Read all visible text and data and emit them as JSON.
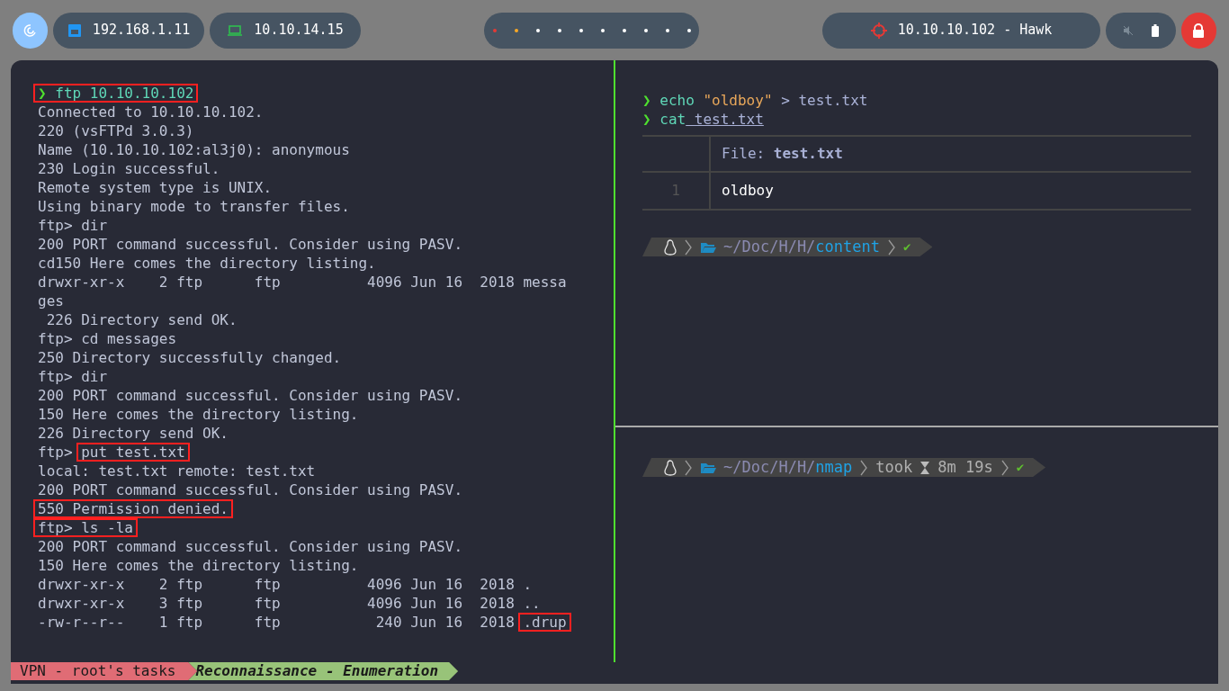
{
  "topbar": {
    "ips": [
      {
        "kind": "ethernet",
        "text": "192.168.1.11"
      },
      {
        "kind": "laptop",
        "text": "10.10.14.15"
      }
    ],
    "workspaces": [
      {
        "color": "#e53935"
      },
      {
        "color": "#f9a825"
      },
      {
        "color": "#ffffff"
      },
      {
        "color": "#ffffff"
      },
      {
        "color": "#ffffff"
      },
      {
        "color": "#ffffff"
      },
      {
        "color": "#ffffff"
      },
      {
        "color": "#ffffff"
      },
      {
        "color": "#ffffff"
      },
      {
        "color": "#ffffff"
      }
    ],
    "target": "10.10.10.102 - Hawk"
  },
  "left_pane": {
    "lines": [
      {
        "kind": "prompt",
        "segments": [
          {
            "text": "❯ ftp 10.10.10.102",
            "boxed": true
          }
        ]
      },
      {
        "kind": "output",
        "segments": [
          {
            "text": "Connected to 10.10.10.102.",
            "boxed": false
          }
        ]
      },
      {
        "kind": "output",
        "segments": [
          {
            "text": "220 (vsFTPd 3.0.3)",
            "boxed": false
          }
        ]
      },
      {
        "kind": "output",
        "segments": [
          {
            "text": "Name (10.10.10.102:al3j0): anonymous",
            "boxed": false
          }
        ]
      },
      {
        "kind": "output",
        "segments": [
          {
            "text": "230 Login successful.",
            "boxed": false
          }
        ]
      },
      {
        "kind": "output",
        "segments": [
          {
            "text": "Remote system type is UNIX.",
            "boxed": false
          }
        ]
      },
      {
        "kind": "output",
        "segments": [
          {
            "text": "Using binary mode to transfer files.",
            "boxed": false
          }
        ]
      },
      {
        "kind": "output",
        "segments": [
          {
            "text": "ftp> dir",
            "boxed": false
          }
        ]
      },
      {
        "kind": "output",
        "segments": [
          {
            "text": "200 PORT command successful. Consider using PASV.",
            "boxed": false
          }
        ]
      },
      {
        "kind": "output",
        "segments": [
          {
            "text": "cd150 Here comes the directory listing.",
            "boxed": false
          }
        ]
      },
      {
        "kind": "output",
        "segments": [
          {
            "text": "drwxr-xr-x    2 ftp      ftp          4096 Jun 16  2018 messa",
            "boxed": false
          }
        ]
      },
      {
        "kind": "output",
        "segments": [
          {
            "text": "ges",
            "boxed": false
          }
        ]
      },
      {
        "kind": "output",
        "segments": [
          {
            "text": " 226 Directory send OK.",
            "boxed": false
          }
        ]
      },
      {
        "kind": "output",
        "segments": [
          {
            "text": "ftp> cd messages",
            "boxed": false
          }
        ]
      },
      {
        "kind": "output",
        "segments": [
          {
            "text": "250 Directory successfully changed.",
            "boxed": false
          }
        ]
      },
      {
        "kind": "output",
        "segments": [
          {
            "text": "ftp> dir",
            "boxed": false
          }
        ]
      },
      {
        "kind": "output",
        "segments": [
          {
            "text": "200 PORT command successful. Consider using PASV.",
            "boxed": false
          }
        ]
      },
      {
        "kind": "output",
        "segments": [
          {
            "text": "150 Here comes the directory listing.",
            "boxed": false
          }
        ]
      },
      {
        "kind": "output",
        "segments": [
          {
            "text": "226 Directory send OK.",
            "boxed": false
          }
        ]
      },
      {
        "kind": "output",
        "segments": [
          {
            "text": "ftp> ",
            "boxed": false
          },
          {
            "text": "put test.txt",
            "boxed": true
          }
        ]
      },
      {
        "kind": "output",
        "segments": [
          {
            "text": "local: test.txt remote: test.txt",
            "boxed": false
          }
        ]
      },
      {
        "kind": "output",
        "segments": [
          {
            "text": "200 PORT command successful. Consider using PASV.",
            "boxed": false
          }
        ]
      },
      {
        "kind": "output",
        "segments": [
          {
            "text": "550 Permission denied.",
            "boxed": true
          }
        ]
      },
      {
        "kind": "output",
        "segments": [
          {
            "text": "ftp> ls -la",
            "boxed": true
          }
        ]
      },
      {
        "kind": "output",
        "segments": [
          {
            "text": "200 PORT command successful. Consider using PASV.",
            "boxed": false
          }
        ]
      },
      {
        "kind": "output",
        "segments": [
          {
            "text": "150 Here comes the directory listing.",
            "boxed": false
          }
        ]
      },
      {
        "kind": "output",
        "segments": [
          {
            "text": "drwxr-xr-x    2 ftp      ftp          4096 Jun 16  2018 .",
            "boxed": false
          }
        ]
      },
      {
        "kind": "output",
        "segments": [
          {
            "text": "drwxr-xr-x    3 ftp      ftp          4096 Jun 16  2018 ..",
            "boxed": false
          }
        ]
      },
      {
        "kind": "output",
        "segments": [
          {
            "text": "-rw-r--r--    1 ftp      ftp           240 Jun 16  2018 ",
            "boxed": false
          },
          {
            "text": ".drup",
            "boxed": true
          }
        ]
      }
    ]
  },
  "right_top": {
    "commands": [
      {
        "arrow": "❯",
        "parts": [
          {
            "kind": "command",
            "text": "echo"
          },
          {
            "kind": "string",
            "text": "\"oldboy\""
          },
          {
            "kind": "plain",
            "text": "> test.txt"
          }
        ]
      },
      {
        "arrow": "❯",
        "parts": [
          {
            "kind": "command",
            "text": "cat"
          },
          {
            "kind": "path",
            "text": "test.txt"
          }
        ]
      }
    ],
    "file_view": {
      "header_label": "File:",
      "file_name": "test.txt",
      "rows": [
        {
          "number": "1",
          "text": "oldboy"
        }
      ]
    },
    "prompt": {
      "path_prefix": "~/Doc/H/H/",
      "dir": "content",
      "status": "✔"
    }
  },
  "right_bottom": {
    "prompt": {
      "path_prefix": "~/Doc/H/H/",
      "dir": "nmap",
      "took_label": "took",
      "duration": "8m 19s",
      "status": "✔"
    }
  },
  "status_bar": {
    "session": "VPN - root's tasks",
    "window": "Reconnaissance - Enumeration"
  }
}
